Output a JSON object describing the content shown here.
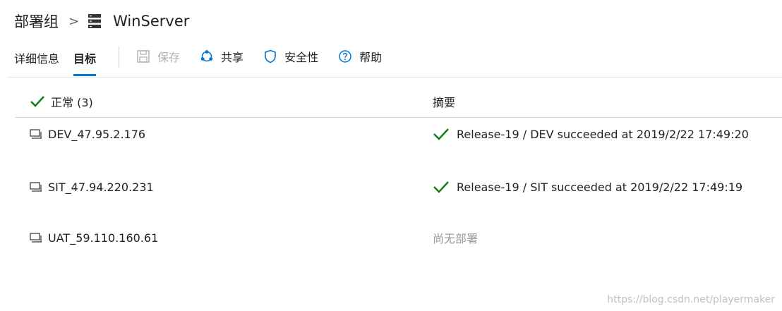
{
  "breadcrumb": {
    "root": "部署组",
    "separator": ">",
    "title": "WinServer"
  },
  "tabs": [
    {
      "label": "详细信息",
      "active": false
    },
    {
      "label": "目标",
      "active": true
    }
  ],
  "actions": [
    {
      "label": "保存",
      "icon": "save-icon",
      "disabled": true
    },
    {
      "label": "共享",
      "icon": "share-icon",
      "disabled": false
    },
    {
      "label": "安全性",
      "icon": "shield-icon",
      "disabled": false
    },
    {
      "label": "帮助",
      "icon": "help-icon",
      "disabled": false
    }
  ],
  "columns": {
    "status": "正常 (3)",
    "summary": "摘要"
  },
  "rows": [
    {
      "name": "DEV_47.95.2.176",
      "summary": "Release-19 / DEV succeeded at 2019/2/22 17:49:20",
      "success": true
    },
    {
      "name": "SIT_47.94.220.231",
      "summary": "Release-19 / SIT succeeded at 2019/2/22 17:49:19",
      "success": true
    },
    {
      "name": "UAT_59.110.160.61",
      "summary": "尚无部署",
      "success": false
    }
  ],
  "colors": {
    "accent": "#0078d4",
    "success": "#107c10",
    "muted": "#9a9a9a"
  },
  "watermark": "https://blog.csdn.net/playermaker"
}
